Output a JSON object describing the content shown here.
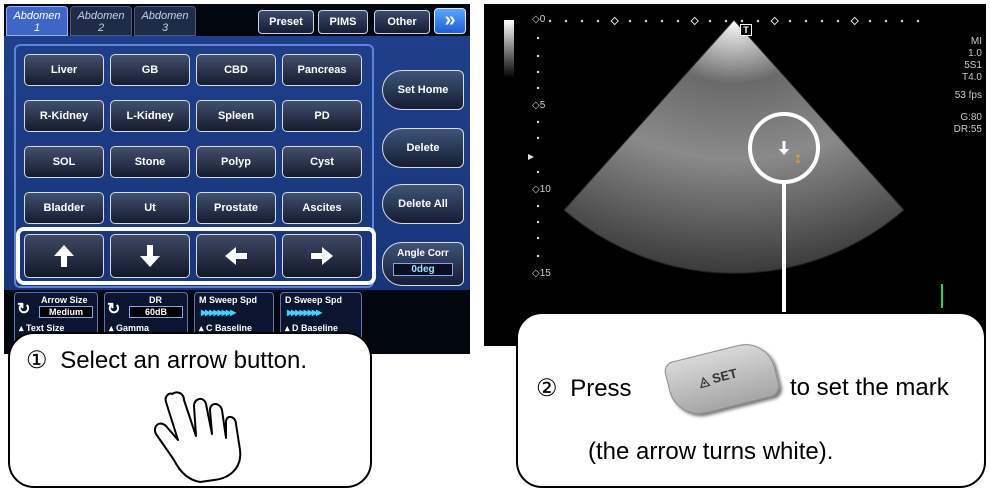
{
  "tabs": [
    {
      "name": "Abdomen",
      "number": "1",
      "active": true
    },
    {
      "name": "Abdomen",
      "number": "2",
      "active": false
    },
    {
      "name": "Abdomen",
      "number": "3",
      "active": false
    }
  ],
  "header_buttons": {
    "preset": "Preset",
    "pims": "PIMS",
    "other": "Other",
    "next_icon": "double-chevron-right-icon"
  },
  "presets": [
    [
      "Liver",
      "GB",
      "CBD",
      "Pancreas"
    ],
    [
      "R-Kidney",
      "L-Kidney",
      "Spleen",
      "PD"
    ],
    [
      "SOL",
      "Stone",
      "Polyp",
      "Cyst"
    ],
    [
      "Bladder",
      "Ut",
      "Prostate",
      "Ascites"
    ]
  ],
  "arrow_buttons": [
    "arrow-up-icon",
    "arrow-down-icon",
    "arrow-left-icon",
    "arrow-right-icon"
  ],
  "side_buttons": {
    "set_home": "Set Home",
    "delete": "Delete",
    "delete_all": "Delete All",
    "angle_corr": "Angle Corr",
    "angle_value": "0deg"
  },
  "knobs": {
    "arrow_size": {
      "label": "Arrow Size",
      "value": "Medium",
      "sub": "Text Size"
    },
    "dr": {
      "label": "DR",
      "value": "60dB",
      "sub": "Gamma"
    }
  },
  "sweeps": {
    "m_sweep": {
      "label": "M Sweep Spd",
      "sub": "C Baseline"
    },
    "d_sweep": {
      "label": "D Sweep Spd",
      "sub": "D Baseline"
    }
  },
  "callout1": {
    "number": "①",
    "text": "Select an arrow button."
  },
  "callout2": {
    "number": "②",
    "press": "Press",
    "key_label": "SET",
    "after": "to set the mark",
    "line2": "(the arrow turns white)."
  },
  "ultrasound": {
    "t_marker": "T",
    "mi": "MI",
    "mi_val": "1.0",
    "probe": "5S1",
    "t_val": "T4.0",
    "fps": "53 fps",
    "gain": "G:80",
    "dr": "DR:55",
    "depths": [
      "0",
      "5",
      "10",
      "15"
    ],
    "mark_icon": "arrow-down-icon"
  }
}
